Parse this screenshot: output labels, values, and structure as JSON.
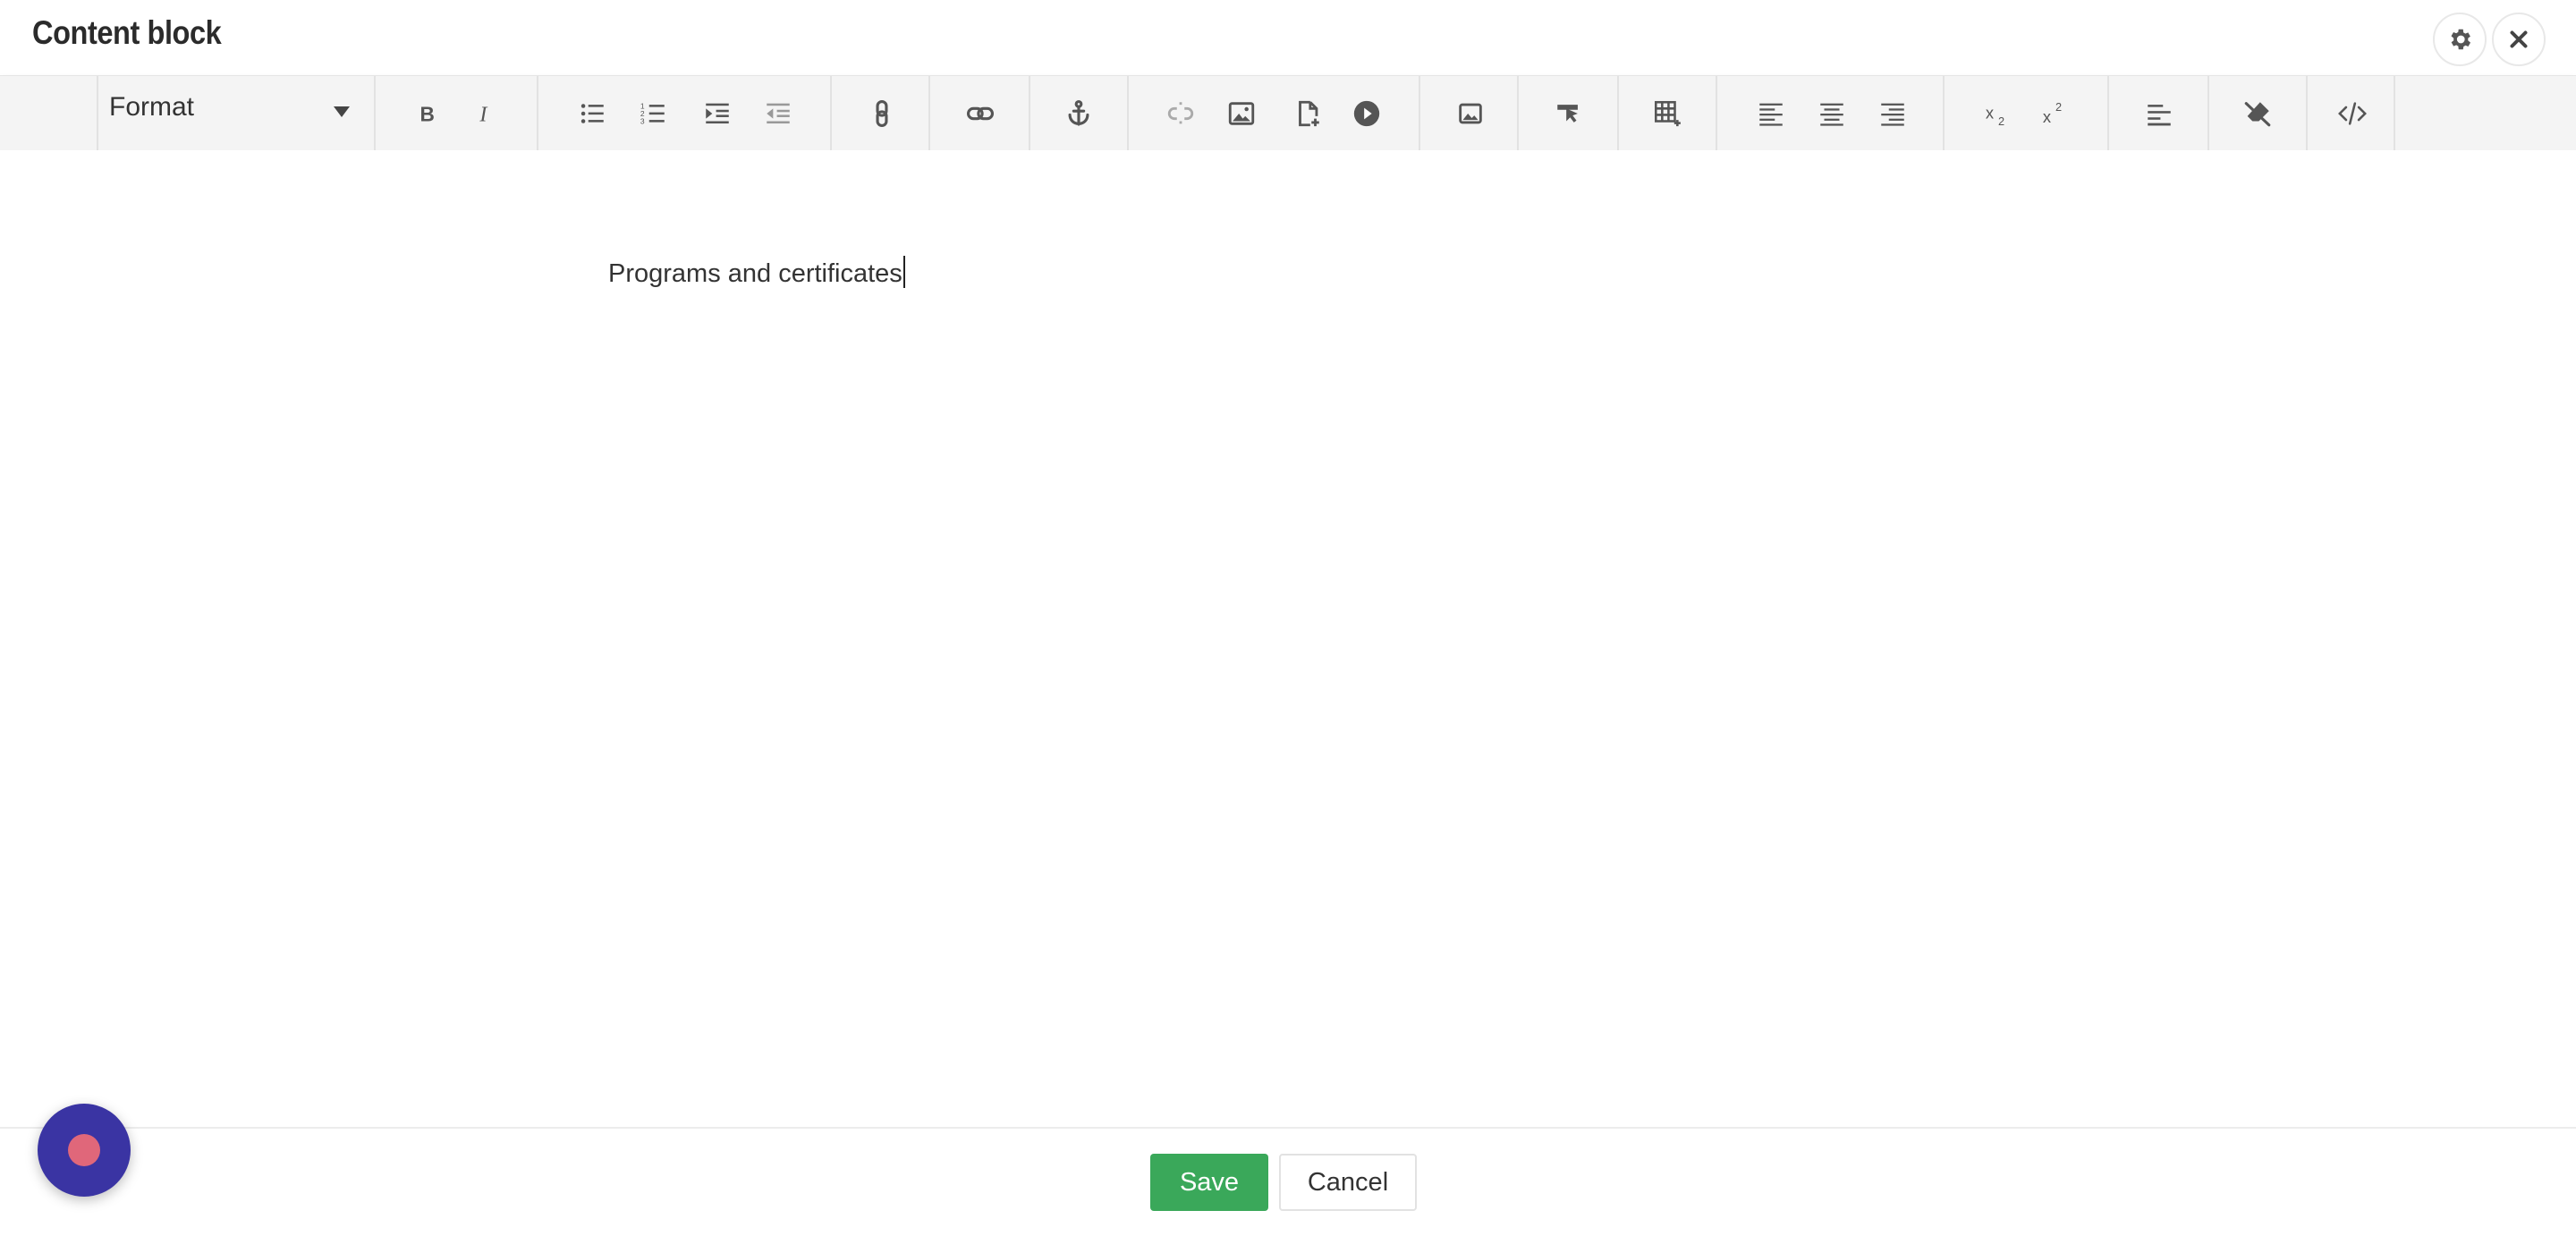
{
  "header": {
    "title": "Content block",
    "settings_icon": "gear-icon",
    "close_icon": "close-icon"
  },
  "toolbar": {
    "format_label": "Format",
    "buttons": [
      "bold-icon",
      "italic-icon",
      "bulleted-list-icon",
      "numbered-list-icon",
      "indent-icon",
      "outdent-icon",
      "link-icon",
      "chain-link-icon",
      "anchor-icon",
      "unlink-icon",
      "image-icon",
      "new-document-icon",
      "play-video-icon",
      "gallery-image-icon",
      "cursor-select-icon",
      "table-icon",
      "align-left-icon",
      "align-center-icon",
      "align-right-icon",
      "subscript-icon",
      "superscript-icon",
      "paragraph-icon",
      "clear-format-icon",
      "source-code-icon"
    ]
  },
  "editor": {
    "text": "Programs and certificates"
  },
  "footer": {
    "save_label": "Save",
    "cancel_label": "Cancel"
  },
  "colors": {
    "save": "#3aa85a",
    "record_button": "#3a34a3",
    "record_dot": "#e0677a",
    "toolbar_bg": "#f4f4f4"
  }
}
